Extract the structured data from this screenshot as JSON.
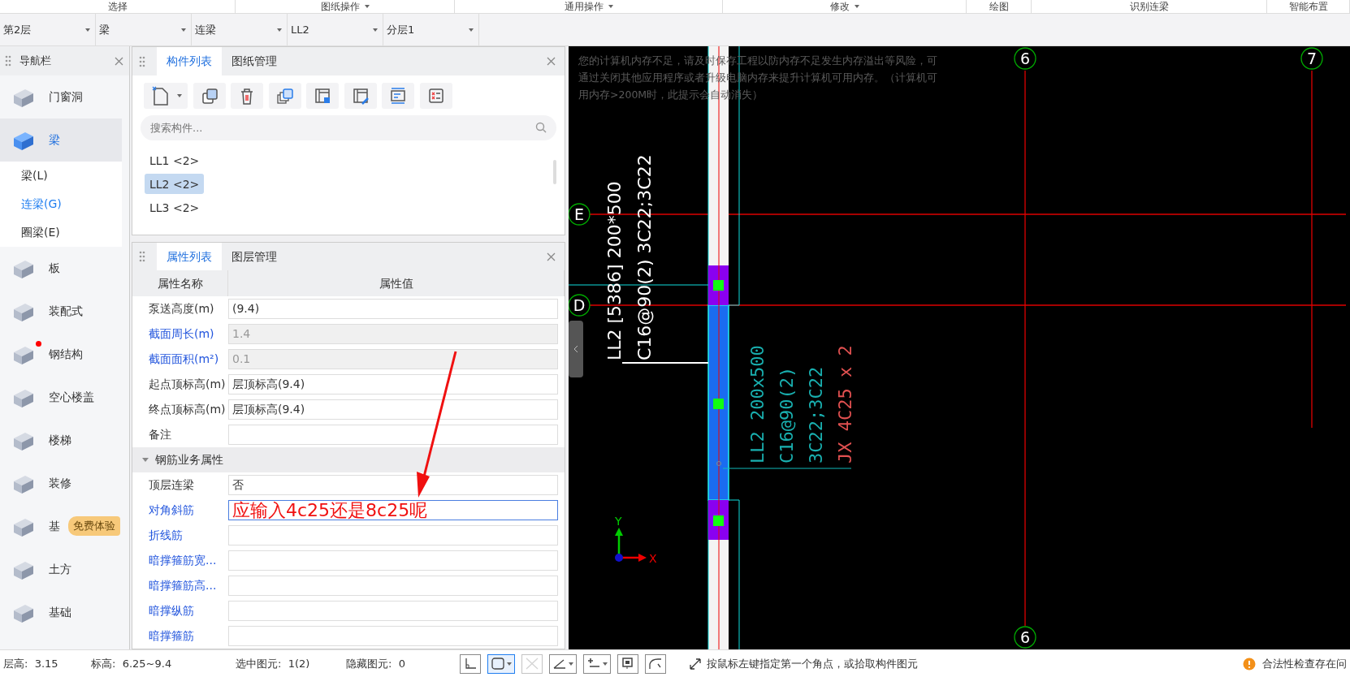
{
  "ribbon_groups": [
    {
      "label": "选择",
      "dropdown": false
    },
    {
      "label": "图纸操作",
      "dropdown": true
    },
    {
      "label": "通用操作",
      "dropdown": true
    },
    {
      "label": "修改",
      "dropdown": true
    },
    {
      "label": "绘图",
      "dropdown": false
    },
    {
      "label": "识别连梁",
      "dropdown": false
    },
    {
      "label": "智能布置",
      "dropdown": false
    }
  ],
  "selectors": [
    "第2层",
    "梁",
    "连梁",
    "LL2",
    "分层1"
  ],
  "nav": {
    "title": "导航栏",
    "items": [
      {
        "label": "门窗洞",
        "selected": false,
        "notification": false
      },
      {
        "label": "梁",
        "selected": true,
        "notification": false,
        "children": [
          {
            "label": "梁(L)",
            "selected": false
          },
          {
            "label": "连梁(G)",
            "selected": true
          },
          {
            "label": "圈梁(E)",
            "selected": false
          }
        ]
      },
      {
        "label": "板",
        "selected": false,
        "notification": false
      },
      {
        "label": "装配式",
        "selected": false,
        "notification": false
      },
      {
        "label": "钢结构",
        "selected": false,
        "notification": true
      },
      {
        "label": "空心楼盖",
        "selected": false,
        "notification": false
      },
      {
        "label": "楼梯",
        "selected": false,
        "notification": false
      },
      {
        "label": "装修",
        "selected": false,
        "notification": false
      },
      {
        "label": "基",
        "selected": false,
        "notification": false,
        "badge": "免费体验"
      },
      {
        "label": "土方",
        "selected": false,
        "notification": false
      },
      {
        "label": "基础",
        "selected": false,
        "notification": false
      }
    ]
  },
  "component_panel": {
    "tabs": [
      {
        "label": "构件列表",
        "selected": true
      },
      {
        "label": "图纸管理",
        "selected": false
      }
    ],
    "search": {
      "placeholder": "搜索构件..."
    },
    "items": [
      {
        "label": "LL1 <2>",
        "selected": false
      },
      {
        "label": "LL2 <2>",
        "selected": true
      },
      {
        "label": "LL3 <2>",
        "selected": false
      }
    ]
  },
  "property_panel": {
    "tabs": [
      {
        "label": "属性列表",
        "selected": true
      },
      {
        "label": "图层管理",
        "selected": false
      }
    ],
    "columns": [
      "属性名称",
      "属性值"
    ],
    "rows": [
      {
        "kind": "field",
        "name": "泵送高度(m)",
        "value": "(9.4)",
        "linked": false,
        "readonly": false,
        "focused": false
      },
      {
        "kind": "field",
        "name": "截面周长(m)",
        "value": "1.4",
        "linked": true,
        "readonly": true,
        "focused": false
      },
      {
        "kind": "field",
        "name": "截面面积(m²)",
        "value": "0.1",
        "linked": true,
        "readonly": true,
        "focused": false
      },
      {
        "kind": "field",
        "name": "起点顶标高(m)",
        "value": "层顶标高(9.4)",
        "linked": false,
        "readonly": false,
        "focused": false
      },
      {
        "kind": "field",
        "name": "终点顶标高(m)",
        "value": "层顶标高(9.4)",
        "linked": false,
        "readonly": false,
        "focused": false
      },
      {
        "kind": "field",
        "name": "备注",
        "value": "",
        "linked": false,
        "readonly": false,
        "focused": false
      },
      {
        "kind": "group",
        "name": "钢筋业务属性",
        "expanded": true
      },
      {
        "kind": "field",
        "name": "顶层连梁",
        "value": "否",
        "linked": false,
        "readonly": false,
        "focused": false
      },
      {
        "kind": "field",
        "name": "对角斜筋",
        "value": "应输入4c25还是8c25呢",
        "linked": true,
        "readonly": false,
        "focused": true
      },
      {
        "kind": "field",
        "name": "折线筋",
        "value": "",
        "linked": true,
        "readonly": false,
        "focused": false
      },
      {
        "kind": "field",
        "name": "暗撑箍筋宽...",
        "value": "",
        "linked": true,
        "readonly": false,
        "focused": false
      },
      {
        "kind": "field",
        "name": "暗撑箍筋高...",
        "value": "",
        "linked": true,
        "readonly": false,
        "focused": false
      },
      {
        "kind": "field",
        "name": "暗撑纵筋",
        "value": "",
        "linked": true,
        "readonly": false,
        "focused": false
      },
      {
        "kind": "field",
        "name": "暗撑箍筋",
        "value": "",
        "linked": true,
        "readonly": false,
        "focused": false
      }
    ]
  },
  "canvas": {
    "notice": "您的计算机内存不足，请及时保存工程以防内存不足发生内存溢出等风险，可通过关闭其他应用程序或者升级电脑内存来提升计算机可用内存。（计算机可用内存>200M时，此提示会自动消失）",
    "axis_labels": [
      "6",
      "7",
      "E",
      "D",
      "6"
    ],
    "beam_label": [
      "LL2 [5386] 200*500",
      "C16@90(2) 3C22;3C22"
    ],
    "beam_annotation": [
      "LL2 200x500",
      "C16@90(2)",
      "3C22;3C22"
    ],
    "rebar_note": "JX 4C25 x 2",
    "axis_x": "X",
    "axis_y": "Y"
  },
  "status_bar": {
    "fields": [
      {
        "label": "层高:",
        "value": "3.15"
      },
      {
        "label": "标高:",
        "value": "6.25~9.4"
      },
      {
        "label": "选中图元:",
        "value": "1(2)"
      },
      {
        "label": "隐藏图元:",
        "value": "0"
      }
    ],
    "tools": [
      {
        "selected": false,
        "disabled": false,
        "dropdown": false
      },
      {
        "selected": true,
        "disabled": false,
        "dropdown": true
      },
      {
        "selected": false,
        "disabled": true,
        "dropdown": false
      },
      {
        "selected": false,
        "disabled": false,
        "dropdown": true
      },
      {
        "selected": false,
        "disabled": false,
        "dropdown": true
      },
      {
        "selected": false,
        "disabled": false,
        "dropdown": false
      },
      {
        "selected": false,
        "disabled": false,
        "dropdown": false
      }
    ],
    "hint": "按鼠标左键指定第一个角点，或拾取构件图元",
    "warning": "合法性检查存在问"
  }
}
